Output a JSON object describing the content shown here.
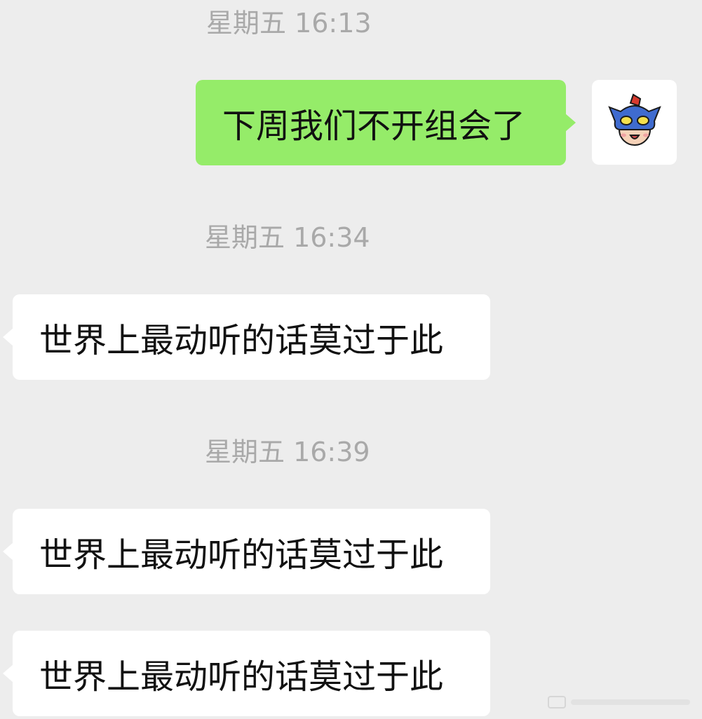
{
  "chat": {
    "messages": [
      {
        "timestamp": "星期五 16:13",
        "direction": "sent",
        "text": "下周我们不开组会了",
        "avatar_icon": "cartoon-hero-mask-avatar-icon"
      },
      {
        "timestamp": "星期五 16:34",
        "direction": "received",
        "text": "世界上最动听的话莫过于此"
      },
      {
        "timestamp": "星期五 16:39",
        "direction": "received",
        "text": "世界上最动听的话莫过于此"
      },
      {
        "direction": "received",
        "text": "世界上最动听的话莫过于此"
      }
    ]
  },
  "colors": {
    "background": "#ededed",
    "sent_bubble": "#95ec69",
    "received_bubble": "#ffffff",
    "timestamp_text": "#a9a9a9",
    "message_text": "#111111"
  }
}
